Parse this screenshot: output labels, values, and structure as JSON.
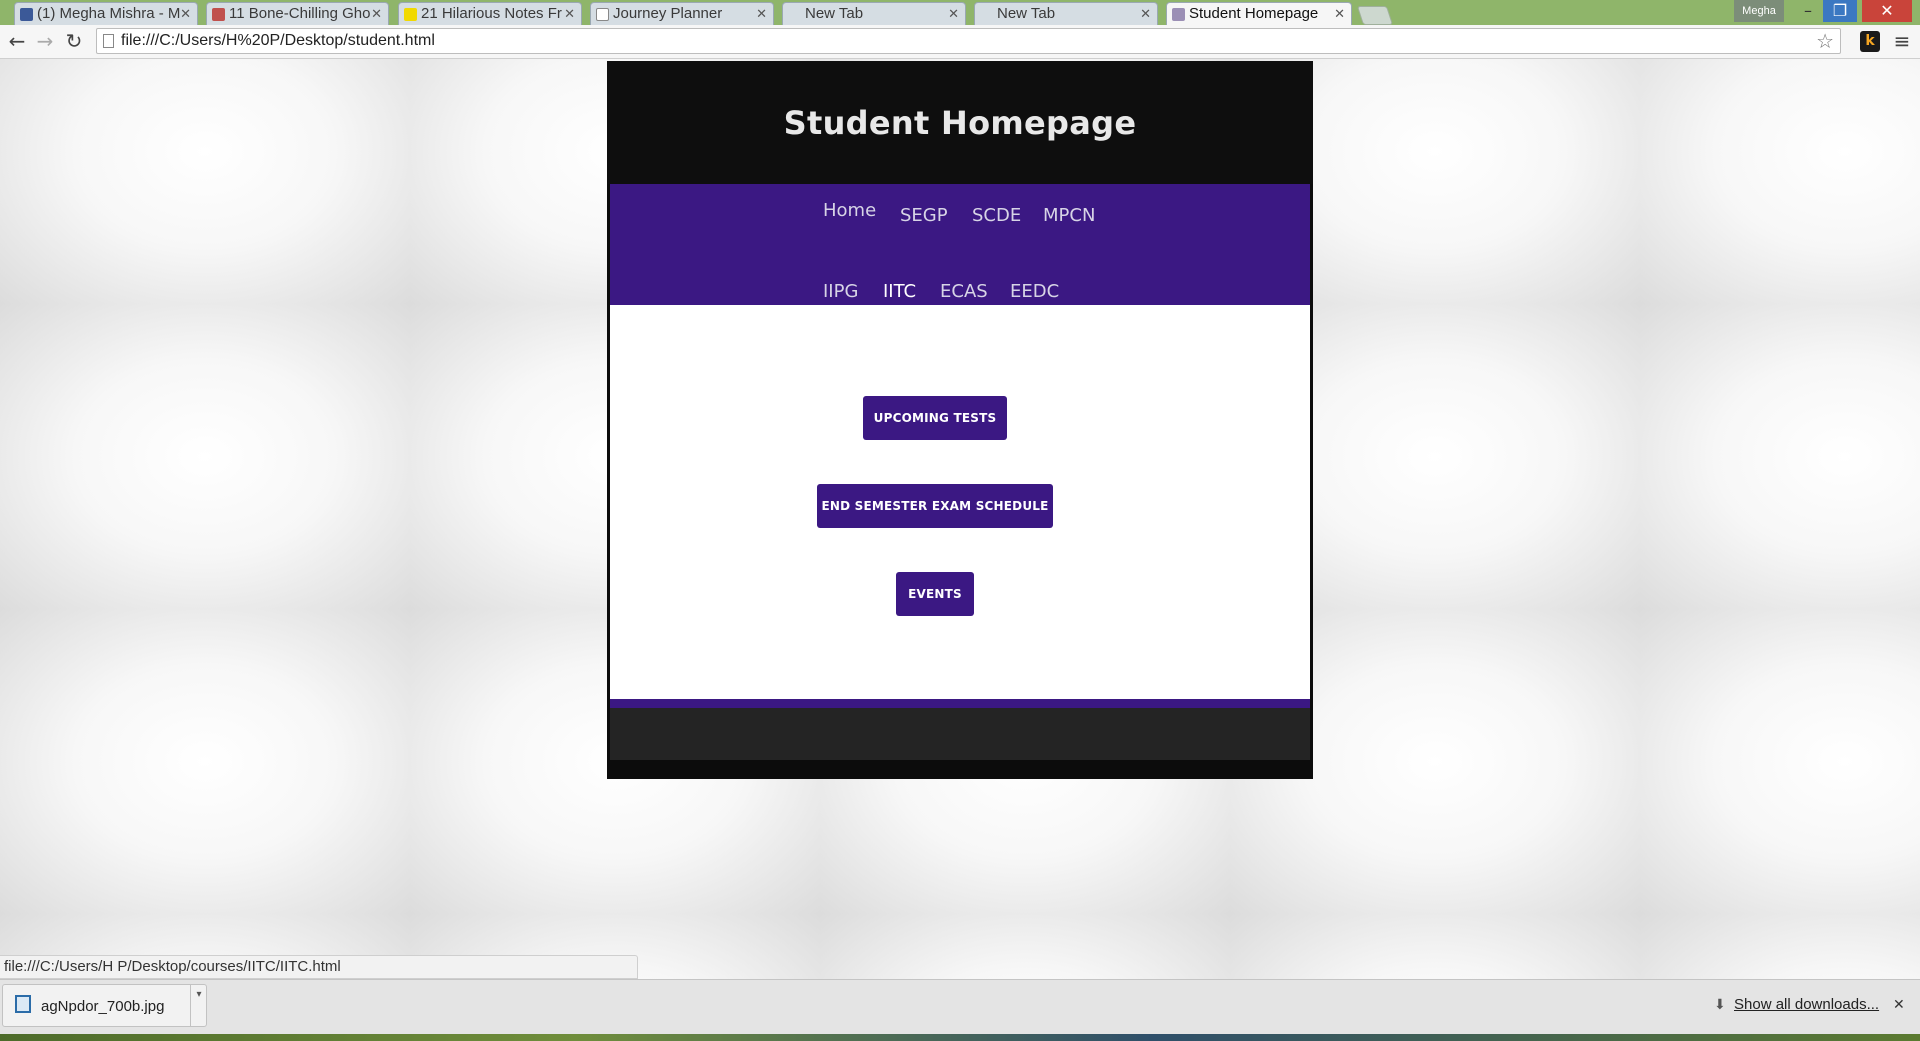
{
  "browser": {
    "tabs": [
      {
        "label": "(1) Megha Mishra - M",
        "favicon_color": "#3b5998"
      },
      {
        "label": "11 Bone-Chilling Gho",
        "favicon_color": "#c0504d"
      },
      {
        "label": "21 Hilarious Notes Fr",
        "favicon_color": "#f1d900"
      },
      {
        "label": "Journey Planner",
        "favicon_color": "#ffffff"
      },
      {
        "label": "New Tab",
        "favicon_color": ""
      },
      {
        "label": "New Tab",
        "favicon_color": ""
      },
      {
        "label": "Student Homepage",
        "favicon_color": "#9b8fb5"
      }
    ],
    "active_tab_index": 6,
    "profile_name": "Megha",
    "url": "file:///C:/Users/H%20P/Desktop/student.html"
  },
  "page": {
    "title": "Student Homepage",
    "nav_items": [
      {
        "label": "Home"
      },
      {
        "label": "SEGP"
      },
      {
        "label": "SCDE"
      },
      {
        "label": "MPCN"
      },
      {
        "label": "IIPG"
      },
      {
        "label": "IITC"
      },
      {
        "label": "ECAS"
      },
      {
        "label": "EEDC"
      }
    ],
    "buttons": {
      "upcoming_tests": "UPCOMING TESTS",
      "exam_schedule": "END SEMESTER EXAM SCHEDULE",
      "events": "EVENTS"
    },
    "colors": {
      "accent": "#3b1883",
      "header_bg": "#0e0e0e",
      "footer_bg": "#242424"
    }
  },
  "status_bar": {
    "text": "file:///C:/Users/H P/Desktop/courses/IITC/IITC.html"
  },
  "downloads": {
    "file_name": "agNpdor_700b.jpg",
    "show_all_label": "Show all downloads..."
  }
}
